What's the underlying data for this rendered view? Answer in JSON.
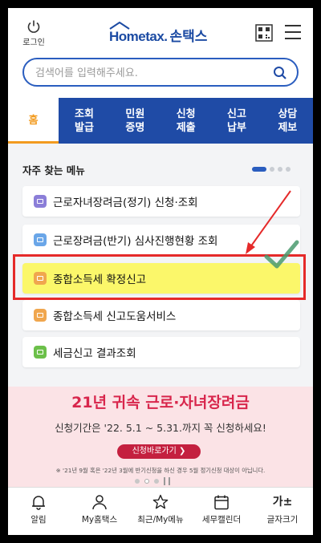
{
  "header": {
    "login_label": "로그인",
    "logo_en": "Hometax.",
    "logo_kr": "손택스"
  },
  "search": {
    "placeholder": "검색어를 입력해주세요."
  },
  "tabs": [
    {
      "label": "홈"
    },
    {
      "label": "조회\n발급"
    },
    {
      "label": "민원\n증명"
    },
    {
      "label": "신청\n제출"
    },
    {
      "label": "신고\n납부"
    },
    {
      "label": "상담\n제보"
    }
  ],
  "favorites": {
    "title": "자주 찾는 메뉴",
    "items": [
      {
        "label": "근로자녀장려금(정기) 신청·조회",
        "icon": "calendar-icon",
        "color": "#8b7ed8"
      },
      {
        "label": "근로장려금(반기) 심사진행현황 조회",
        "icon": "chat-icon",
        "color": "#6aa6e8"
      },
      {
        "label": "종합소득세 확정신고",
        "icon": "monitor-icon",
        "color": "#f0a64e"
      },
      {
        "label": "종합소득세 신고도움서비스",
        "icon": "monitor-icon",
        "color": "#f0a64e"
      },
      {
        "label": "세금신고 결과조회",
        "icon": "chat-icon",
        "color": "#6cc04a"
      }
    ]
  },
  "banner": {
    "title": "21년 귀속 근로·자녀장려금",
    "subtitle": "신청기간은 '22. 5.1 ~ 5.31.까지 꼭 신청하세요!",
    "button": "신청바로가기  ❯",
    "note": "※ '21년 9월 혹은 '22년 3월에 반기신청을 하신 경우 5월 정기신청 대상이 아닙니다."
  },
  "bottom_nav": [
    {
      "label": "알림",
      "icon": "bell-icon"
    },
    {
      "label": "My홈택스",
      "icon": "person-icon"
    },
    {
      "label": "최근/My메뉴",
      "icon": "star-icon"
    },
    {
      "label": "세무캘린더",
      "icon": "calendar-icon"
    },
    {
      "label": "글자크기",
      "icon": "font-size-icon",
      "glyph": "가±"
    }
  ],
  "colors": {
    "brand_blue": "#1f4ba6",
    "active_tab": "#f29b1f",
    "highlight": "#fbf76a",
    "annotation_red": "#e52a2a",
    "banner_bg": "#fbe3e6"
  }
}
